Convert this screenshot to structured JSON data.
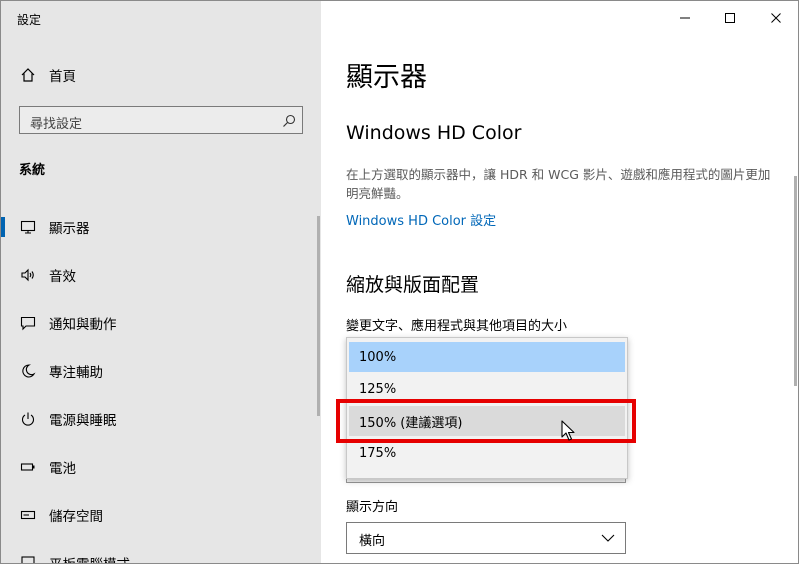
{
  "window": {
    "title": "設定"
  },
  "sidebar": {
    "home_label": "首頁",
    "search_placeholder": "尋找設定",
    "section_label": "系統",
    "items": [
      {
        "label": "顯示器",
        "icon": "monitor-icon",
        "active": true
      },
      {
        "label": "音效",
        "icon": "speaker-icon"
      },
      {
        "label": "通知與動作",
        "icon": "notification-icon"
      },
      {
        "label": "專注輔助",
        "icon": "moon-icon"
      },
      {
        "label": "電源與睡眠",
        "icon": "power-icon"
      },
      {
        "label": "電池",
        "icon": "battery-icon"
      },
      {
        "label": "儲存空間",
        "icon": "storage-icon"
      },
      {
        "label": "平板電腦模式",
        "icon": "tablet-icon"
      }
    ]
  },
  "main": {
    "page_title": "顯示器",
    "hd_color": {
      "heading": "Windows HD Color",
      "description": "在上方選取的顯示器中，讓 HDR 和 WCG 影片、遊戲和應用程式的圖片更加明亮鮮豔。",
      "link": "Windows HD Color 設定"
    },
    "scale_layout": {
      "heading": "縮放與版面配置",
      "scale_label": "變更文字、應用程式與其他項目的大小",
      "scale_options": [
        "100%",
        "125%",
        "150% (建議選項)",
        "175%"
      ],
      "selected_index": 0,
      "hovered_index": 2,
      "orientation_label": "顯示方向",
      "orientation_value": "橫向"
    }
  },
  "colors": {
    "accent": "#0067b8",
    "highlight_box": "#e60000",
    "selected_option": "#a8d2fb"
  }
}
